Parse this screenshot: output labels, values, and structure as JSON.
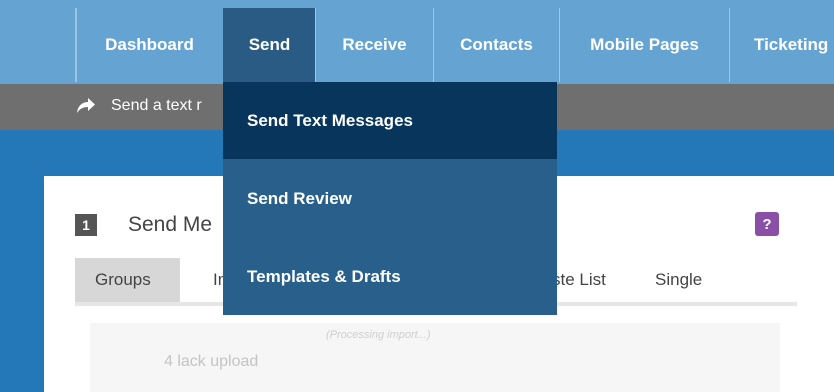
{
  "nav": {
    "items": [
      {
        "label": "Dashboard"
      },
      {
        "label": "Send"
      },
      {
        "label": "Receive"
      },
      {
        "label": "Contacts"
      },
      {
        "label": "Mobile Pages"
      },
      {
        "label": "Ticketing"
      }
    ],
    "active": "Send"
  },
  "breadcrumb": {
    "icon": "share-arrow-icon",
    "text": "Send a text r"
  },
  "dropdown": {
    "items": [
      {
        "label": "Send Text Messages"
      },
      {
        "label": "Send Review"
      },
      {
        "label": "Templates & Drafts"
      }
    ]
  },
  "section": {
    "step": "1",
    "title": "Send Me",
    "help_label": "?"
  },
  "tabs": [
    {
      "label": "Groups"
    },
    {
      "label": "Inb"
    },
    {
      "label": "ste List"
    },
    {
      "label": "Single"
    }
  ],
  "content": {
    "processing": "(Processing import...)",
    "upload_text": "4 lack upload"
  },
  "colors": {
    "nav_bg": "#65a4d2",
    "nav_active": "#2a5b85",
    "dropdown_bg": "#28608b",
    "dropdown_hover": "#08355c",
    "help_button": "#8a4fa6",
    "page_bg": "#2478b8"
  }
}
